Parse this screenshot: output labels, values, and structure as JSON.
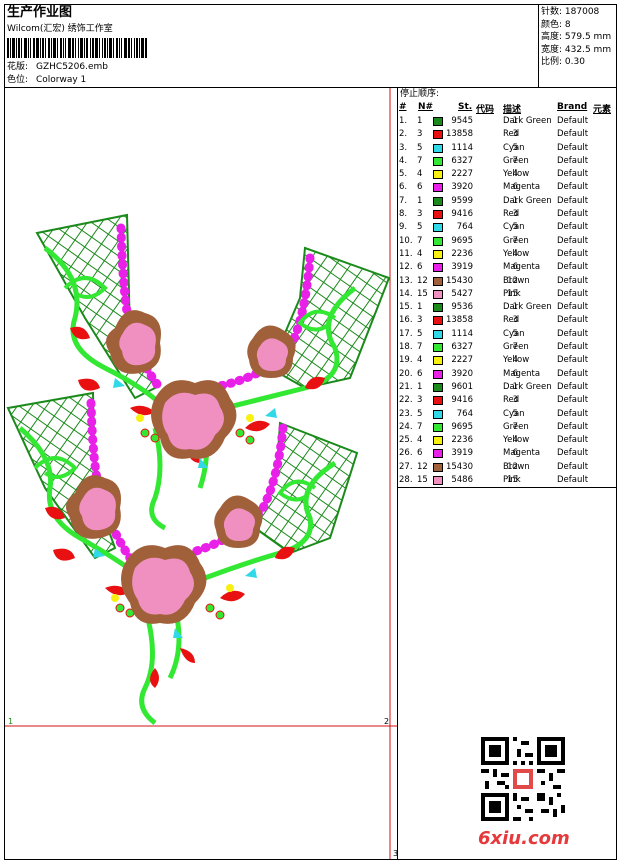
{
  "header": {
    "title": "生产作业图",
    "company": "Wilcom(汇宏) 绣饰工作室",
    "design_label": "花版:",
    "design_file": "GZHC5206.emb",
    "colorway_label": "色位:",
    "colorway_value": "Colorway 1"
  },
  "stats": [
    {
      "label": "针数:",
      "value": "187008"
    },
    {
      "label": "颜色:",
      "value": "8"
    },
    {
      "label": "高度:",
      "value": "579.5 mm"
    },
    {
      "label": "宽度:",
      "value": "432.5 mm"
    },
    {
      "label": "比例:",
      "value": "0.30"
    }
  ],
  "stop_sequence": {
    "title": "停止顺序:",
    "headers": {
      "num": "#",
      "needle": "N#",
      "st": "St.",
      "code": "代码",
      "desc": "描述",
      "brand": "Brand",
      "element": "元素"
    },
    "rows": [
      {
        "idx": "1.",
        "n": "1",
        "st": "9545",
        "code": "1",
        "desc": "Dark Green",
        "brand": "Default",
        "color": "#1a8a1a"
      },
      {
        "idx": "2.",
        "n": "3",
        "st": "13858",
        "code": "3",
        "desc": "Red",
        "brand": "Default",
        "color": "#e81010"
      },
      {
        "idx": "3.",
        "n": "5",
        "st": "1114",
        "code": "5",
        "desc": "Cyan",
        "brand": "Default",
        "color": "#30d8e8"
      },
      {
        "idx": "4.",
        "n": "7",
        "st": "6327",
        "code": "7",
        "desc": "Green",
        "brand": "Default",
        "color": "#33e833"
      },
      {
        "idx": "5.",
        "n": "4",
        "st": "2227",
        "code": "4",
        "desc": "Yellow",
        "brand": "Default",
        "color": "#f8f010"
      },
      {
        "idx": "6.",
        "n": "6",
        "st": "3920",
        "code": "6",
        "desc": "Magenta",
        "brand": "Default",
        "color": "#e820e8"
      },
      {
        "idx": "7.",
        "n": "1",
        "st": "9599",
        "code": "1",
        "desc": "Dark Green",
        "brand": "Default",
        "color": "#1a8a1a"
      },
      {
        "idx": "8.",
        "n": "3",
        "st": "9416",
        "code": "3",
        "desc": "Red",
        "brand": "Default",
        "color": "#e81010"
      },
      {
        "idx": "9.",
        "n": "5",
        "st": "764",
        "code": "5",
        "desc": "Cyan",
        "brand": "Default",
        "color": "#30d8e8"
      },
      {
        "idx": "10.",
        "n": "7",
        "st": "9695",
        "code": "7",
        "desc": "Green",
        "brand": "Default",
        "color": "#33e833"
      },
      {
        "idx": "11.",
        "n": "4",
        "st": "2236",
        "code": "4",
        "desc": "Yellow",
        "brand": "Default",
        "color": "#f8f010"
      },
      {
        "idx": "12.",
        "n": "6",
        "st": "3919",
        "code": "6",
        "desc": "Magenta",
        "brand": "Default",
        "color": "#e820e8"
      },
      {
        "idx": "13.",
        "n": "12",
        "st": "15430",
        "code": "12",
        "desc": "Brown",
        "brand": "Default",
        "color": "#a0603a"
      },
      {
        "idx": "14.",
        "n": "15",
        "st": "5427",
        "code": "15",
        "desc": "Pink",
        "brand": "Default",
        "color": "#f090c0"
      },
      {
        "idx": "15.",
        "n": "1",
        "st": "9536",
        "code": "1",
        "desc": "Dark Green",
        "brand": "Default",
        "color": "#1a8a1a"
      },
      {
        "idx": "16.",
        "n": "3",
        "st": "13858",
        "code": "3",
        "desc": "Red",
        "brand": "Default",
        "color": "#e81010"
      },
      {
        "idx": "17.",
        "n": "5",
        "st": "1114",
        "code": "5",
        "desc": "Cyan",
        "brand": "Default",
        "color": "#30d8e8"
      },
      {
        "idx": "18.",
        "n": "7",
        "st": "6327",
        "code": "7",
        "desc": "Green",
        "brand": "Default",
        "color": "#33e833"
      },
      {
        "idx": "19.",
        "n": "4",
        "st": "2227",
        "code": "4",
        "desc": "Yellow",
        "brand": "Default",
        "color": "#f8f010"
      },
      {
        "idx": "20.",
        "n": "6",
        "st": "3920",
        "code": "6",
        "desc": "Magenta",
        "brand": "Default",
        "color": "#e820e8"
      },
      {
        "idx": "21.",
        "n": "1",
        "st": "9601",
        "code": "1",
        "desc": "Dark Green",
        "brand": "Default",
        "color": "#1a8a1a"
      },
      {
        "idx": "22.",
        "n": "3",
        "st": "9416",
        "code": "3",
        "desc": "Red",
        "brand": "Default",
        "color": "#e81010"
      },
      {
        "idx": "23.",
        "n": "5",
        "st": "764",
        "code": "5",
        "desc": "Cyan",
        "brand": "Default",
        "color": "#30d8e8"
      },
      {
        "idx": "24.",
        "n": "7",
        "st": "9695",
        "code": "7",
        "desc": "Green",
        "brand": "Default",
        "color": "#33e833"
      },
      {
        "idx": "25.",
        "n": "4",
        "st": "2236",
        "code": "4",
        "desc": "Yellow",
        "brand": "Default",
        "color": "#f8f010"
      },
      {
        "idx": "26.",
        "n": "6",
        "st": "3919",
        "code": "6",
        "desc": "Magenta",
        "brand": "Default",
        "color": "#e820e8"
      },
      {
        "idx": "27.",
        "n": "12",
        "st": "15430",
        "code": "12",
        "desc": "Brown",
        "brand": "Default",
        "color": "#a0603a"
      },
      {
        "idx": "28.",
        "n": "15",
        "st": "5486",
        "code": "15",
        "desc": "Pink",
        "brand": "Default",
        "color": "#f090c0"
      }
    ]
  },
  "design_area": {
    "marker_1": "1",
    "marker_2": "2",
    "marker_3": "3"
  },
  "watermark": {
    "site": "6xiu.com"
  }
}
